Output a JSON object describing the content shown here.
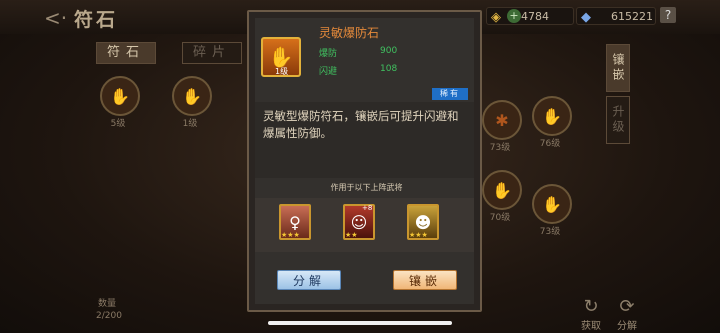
{
  "screen": {
    "back_glyph": "<·",
    "title": "符石",
    "tabs": [
      "符石",
      "碎片"
    ],
    "right_tabs": [
      "镶嵌",
      "升级"
    ],
    "resources": [
      {
        "icon": "gold-ingot-icon",
        "glyph": "◈",
        "value": "4784"
      },
      {
        "icon": "gem-icon",
        "glyph": "◆",
        "value": "615221"
      }
    ],
    "plus_glyph": "+",
    "help_glyph": "?",
    "nodes_left": [
      {
        "glyph": "✋",
        "label": "5级"
      },
      {
        "glyph": "✋",
        "label": "1级"
      }
    ],
    "nodes_right": [
      {
        "glyph": "✱",
        "label": "73级"
      },
      {
        "glyph": "✋",
        "label": "76级"
      },
      {
        "glyph": "✋",
        "label": "70级"
      },
      {
        "glyph": "✋",
        "label": "73级"
      }
    ],
    "count_label": "数量",
    "count_value": "2/200",
    "get_label": "获取",
    "decompose_label": "分解",
    "side_icons": {
      "get": "↻",
      "decompose": "⟳"
    }
  },
  "modal": {
    "title": "灵敏爆防石",
    "level_badge": "1级",
    "gem_glyph": "✋",
    "stats": [
      {
        "name": "爆防",
        "value": "900"
      },
      {
        "name": "闪避",
        "value": "108"
      }
    ],
    "rarity": "稀有",
    "description": "灵敏型爆防符石，镶嵌后可提升闪避和爆属性防御。",
    "generals_caption": "作用于以下上阵武将",
    "heroes": [
      {
        "glyph": "♀",
        "plus": "",
        "stars": "★★★"
      },
      {
        "glyph": "☺",
        "plus": "+8",
        "stars": "★★"
      },
      {
        "glyph": "☻",
        "plus": "",
        "stars": "★★★"
      }
    ],
    "buttons": {
      "decompose": "分解",
      "inlay": "镶嵌"
    }
  },
  "colors": {
    "title_orange": "#e68a3a",
    "stat_green": "#40c060",
    "rarity_blue": "#1f6fc7"
  }
}
